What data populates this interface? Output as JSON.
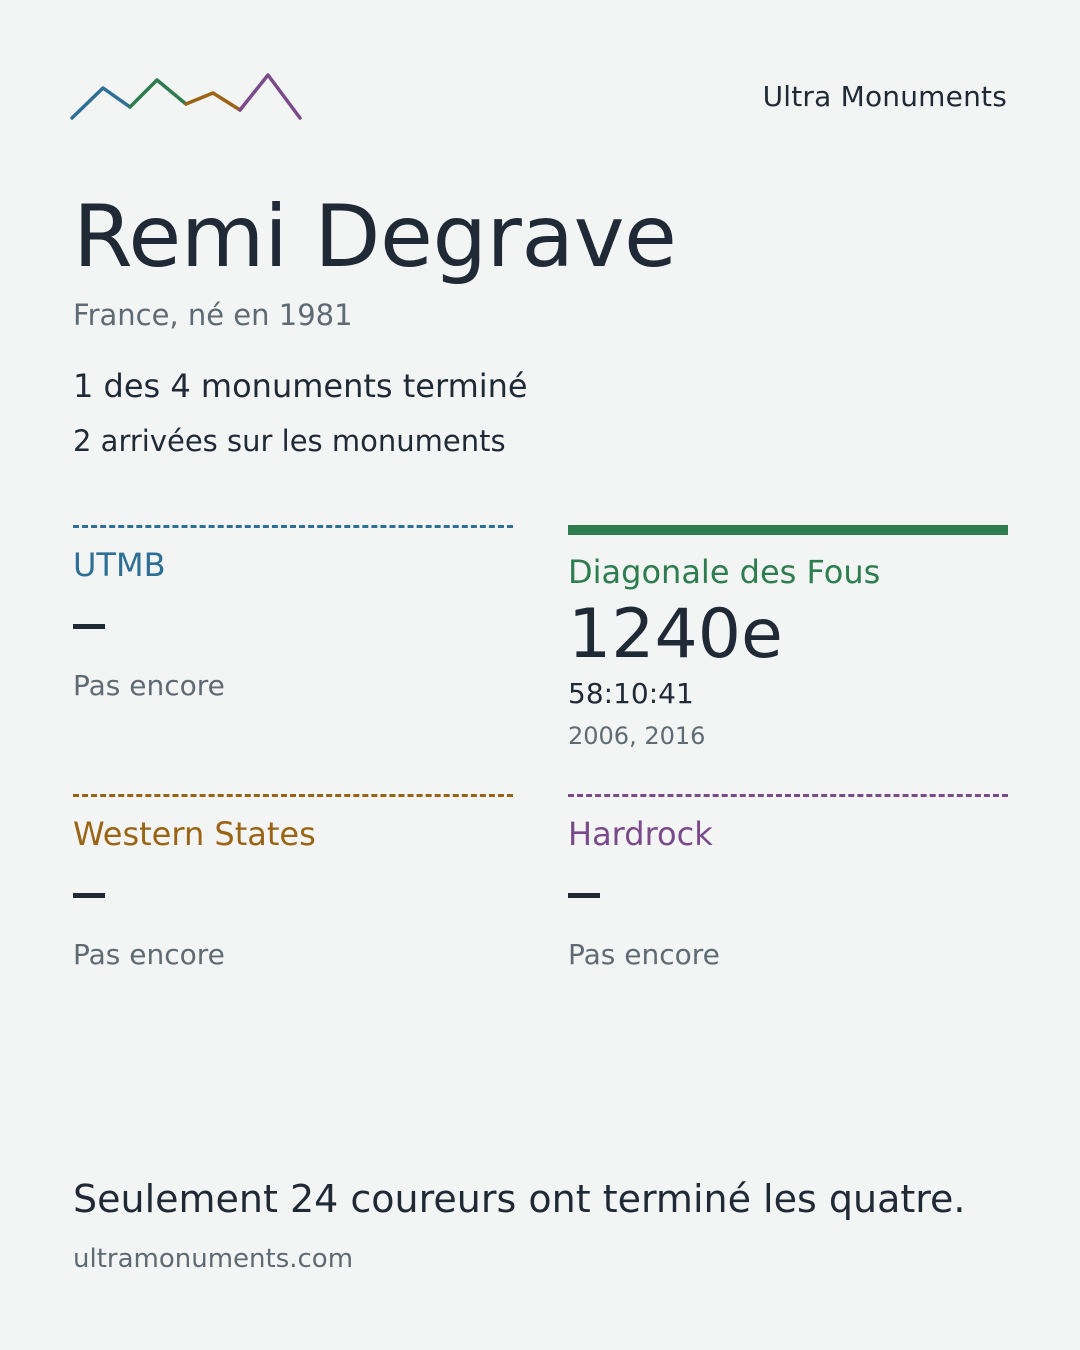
{
  "header": {
    "brand": "Ultra Monuments",
    "logo_icon": "mountain-ridge-logo-icon",
    "logo_colors": [
      "#2e6f96",
      "#2e7d4f",
      "#9a6414",
      "#7b4a8a"
    ]
  },
  "runner": {
    "name": "Remi Degrave",
    "meta": "France, né en 1981",
    "summary_main": "1 des 4 monuments terminé",
    "summary_sub": "2 arrivées sur les monuments"
  },
  "races": {
    "utmb": {
      "name": "UTMB",
      "color": "#2e6f96",
      "status": "Pas encore"
    },
    "diagonale": {
      "name": "Diagonale des Fous",
      "color": "#2e7d4f",
      "rank": "1240e",
      "time": "58:10:41",
      "years": "2006, 2016"
    },
    "western_states": {
      "name": "Western States",
      "color": "#9a6414",
      "status": "Pas encore"
    },
    "hardrock": {
      "name": "Hardrock",
      "color": "#7b4a8a",
      "status": "Pas encore"
    }
  },
  "footer": {
    "tagline": "Seulement 24 coureurs ont terminé les quatre.",
    "url": "ultramonuments.com"
  }
}
